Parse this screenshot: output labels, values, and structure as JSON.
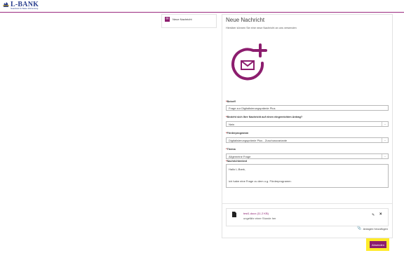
{
  "brand": {
    "name": "L-BANK",
    "tagline": "Staatsbank für Baden-Württemberg",
    "color": "#2b3f8f"
  },
  "sidebar": {
    "items": [
      {
        "label": "Neue Nachricht",
        "icon": "envelope-icon",
        "active": true
      }
    ]
  },
  "main": {
    "title": "Neue Nachricht",
    "subtitle": "Hierüber können Sie eine neue Nachricht an uns versenden",
    "hero_icon": "add-message-icon",
    "accent": "#8c1d6e",
    "fields": {
      "betreff": {
        "label": "Betreff",
        "value": "Frage zur Digitalisierungsprämie Plus"
      },
      "bezug": {
        "label": "Bezieht sich Ihre Nachricht auf einen eingereichten Antrag?",
        "value": "Nein"
      },
      "programm": {
        "label": "Förderprogramm",
        "value": "Digitalisierungsprämie Plus - Zuschussvariante"
      },
      "thema": {
        "label": "Thema",
        "value": "Allgemeine Frage"
      },
      "nachricht": {
        "label": "Nachrichtentext",
        "line1": "Hallo L-Bank,",
        "line2": "ich habe eine Frage zu dem o.g. Förderprogramm:"
      }
    },
    "attachment": {
      "name": "test1.docx (11.2 KB)",
      "time": "ungefähr einer Stunde her"
    },
    "add_attachment_label": "Anlagen hinzufügen",
    "send_label": "Absenden",
    "highlight": "#ffeb2a"
  }
}
